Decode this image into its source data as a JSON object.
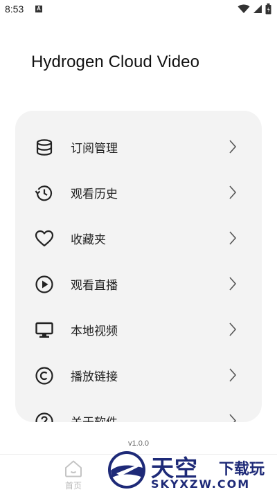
{
  "status_bar": {
    "time": "8:53",
    "notification_letter": "A",
    "icons": [
      "wifi-icon",
      "signal-icon",
      "battery-icon"
    ]
  },
  "app": {
    "title": "Hydrogen Cloud Video"
  },
  "menu": {
    "items": [
      {
        "label": "订阅管理",
        "icon": "database-icon"
      },
      {
        "label": "观看历史",
        "icon": "history-icon"
      },
      {
        "label": "收藏夹",
        "icon": "heart-icon"
      },
      {
        "label": "观看直播",
        "icon": "play-circle-icon"
      },
      {
        "label": "本地视频",
        "icon": "monitor-icon"
      },
      {
        "label": "播放链接",
        "icon": "copyright-icon"
      },
      {
        "label": "关于软件",
        "icon": "help-icon"
      }
    ]
  },
  "footer": {
    "version": "v1.0.0"
  },
  "bottom_nav": {
    "home_label": "首页"
  },
  "watermark": {
    "main": "天空",
    "sub": "下载玩",
    "url": "SKYXZW.COM"
  },
  "colors": {
    "card_bg": "#f3f3f3",
    "watermark_blue": "#1e2a78",
    "nav_inactive": "#b9b9b9"
  }
}
